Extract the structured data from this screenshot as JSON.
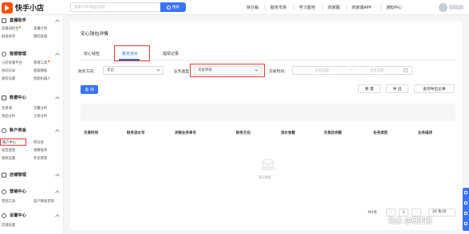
{
  "app": {
    "logo_text": "快手小店"
  },
  "search": {
    "placeholder": "搜索订单/商品/功能",
    "button_label": "搜索"
  },
  "topnav": {
    "items": [
      "快分销",
      "服务市场",
      "学习基地",
      "商家圈",
      "商家端APP",
      "通知中心"
    ]
  },
  "sidebar": {
    "sections": [
      {
        "title": "直播助手",
        "items": [
          "直播间控台",
          "直播计划",
          "群组助手",
          "我的直播"
        ]
      },
      {
        "title": "客服管理",
        "items": [
          "小店客服平台",
          "管理工具",
          "协同记录",
          "客服数据",
          "质检设置",
          "智能机器人"
        ]
      },
      {
        "title": "数据中心",
        "items": [
          "生意通",
          "流量分析",
          "商品分析",
          "交易分析"
        ]
      },
      {
        "title": "账户资金",
        "items": [
          "账户中心",
          "保证金",
          "发票管理",
          "预算账单",
          "收款设置",
          "奖金管理"
        ]
      },
      {
        "title": "店铺管理",
        "items": []
      },
      {
        "title": "营销中心",
        "items": [
          "营销工具",
          "客户精准营销"
        ]
      },
      {
        "title": "设置中心",
        "items": [
          "店铺设置"
        ]
      }
    ]
  },
  "page": {
    "title": "安心钱包详情",
    "tabs": [
      "安心钱包",
      "账务流水",
      "提现记录"
    ],
    "active_tab": "账务流水"
  },
  "filters": {
    "direction_label": "财务方向：",
    "direction_value": "支出",
    "type_label": "业务类型",
    "type_value": "资金转账",
    "time_label": "交易时间：",
    "date_start_placeholder": "开始日期",
    "date_sep": "~",
    "date_end_placeholder": "结束日期",
    "query_button": "查 询",
    "reset_button": "重 置",
    "export_button": "导 出",
    "export_history_button": "查询导出记录"
  },
  "table": {
    "columns": [
      "交易时间",
      "财务流水号",
      "关联业务单号",
      "财务方向",
      "流水金额",
      "交易后余额",
      "业务类型",
      "业务描述"
    ],
    "empty_text": "暂无数据"
  },
  "pagination": {
    "total_text": "共0条",
    "current_page": "1",
    "page_size": "20 条/页"
  },
  "watermark": "头条 @甩手网",
  "colors": {
    "primary": "#3a73f5",
    "brand": "#ff5000",
    "annotation": "#e53935"
  }
}
